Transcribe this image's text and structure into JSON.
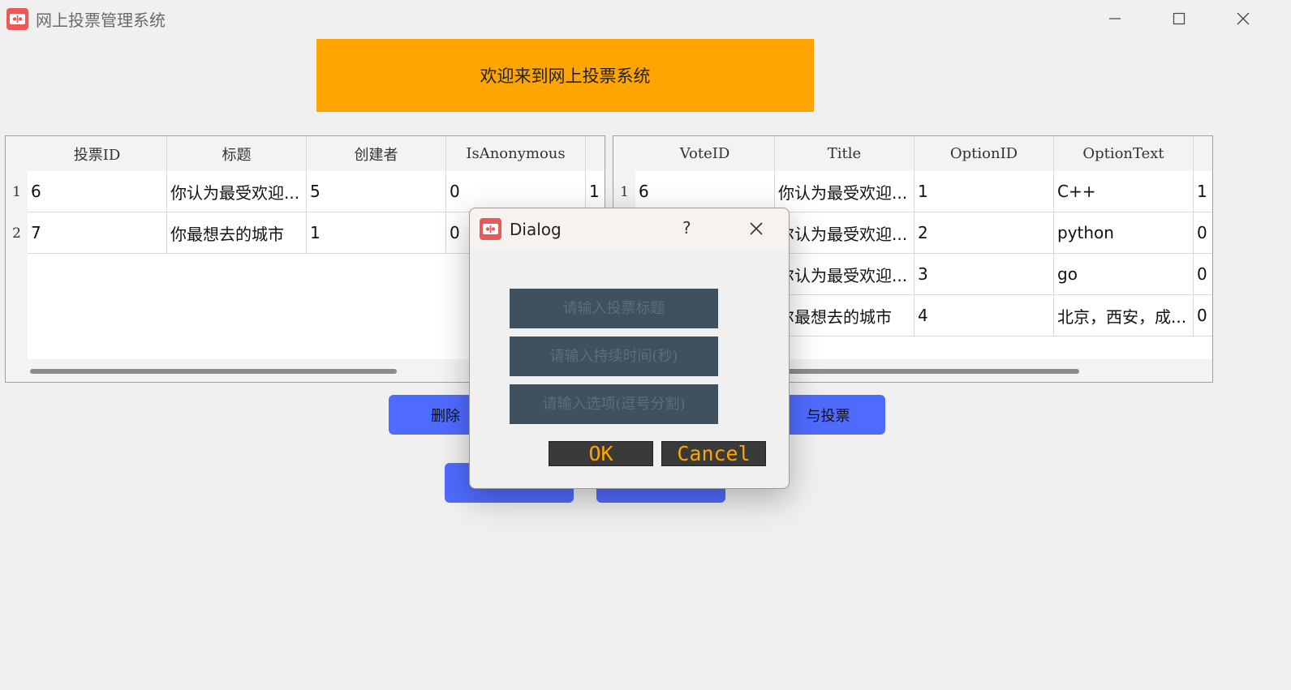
{
  "window": {
    "title": "网上投票管理系统"
  },
  "banner": {
    "text": "欢迎来到网上投票系统"
  },
  "votes_table": {
    "headers": [
      "投票ID",
      "标题",
      "创建者",
      "IsAnonymous",
      ""
    ],
    "row_numbers": [
      "1",
      "2"
    ],
    "rows": [
      [
        "6",
        "你认为最受欢迎...",
        "5",
        "0",
        "1"
      ],
      [
        "7",
        "你最想去的城市",
        "1",
        "0",
        ""
      ]
    ]
  },
  "options_table": {
    "headers": [
      "VoteID",
      "Title",
      "OptionID",
      "OptionText",
      ""
    ],
    "row_numbers": [
      "1"
    ],
    "rows": [
      [
        "6",
        "你认为最受欢迎...",
        "1",
        "C++",
        "1"
      ],
      [
        "",
        "尔认为最受欢迎...",
        "2",
        "python",
        "0"
      ],
      [
        "",
        "尔认为最受欢迎...",
        "3",
        "go",
        "0"
      ],
      [
        "",
        "尔最想去的城市",
        "4",
        "北京，西安，成...",
        "0"
      ]
    ]
  },
  "buttons": {
    "delete_partial": "删除",
    "vote_partial": "与投票"
  },
  "dialog": {
    "title": "Dialog",
    "help": "?",
    "title_placeholder": "请输入投票标题",
    "duration_placeholder": "请输入持续时间(秒)",
    "options_placeholder": "请输入选项(逗号分割)",
    "ok_label": "OK",
    "cancel_label": "Cancel"
  },
  "colors": {
    "banner": "#ffa500",
    "action_button": "#4f6bff",
    "dialog_input": "#3f505e",
    "dialog_button_text": "#ffa500"
  }
}
